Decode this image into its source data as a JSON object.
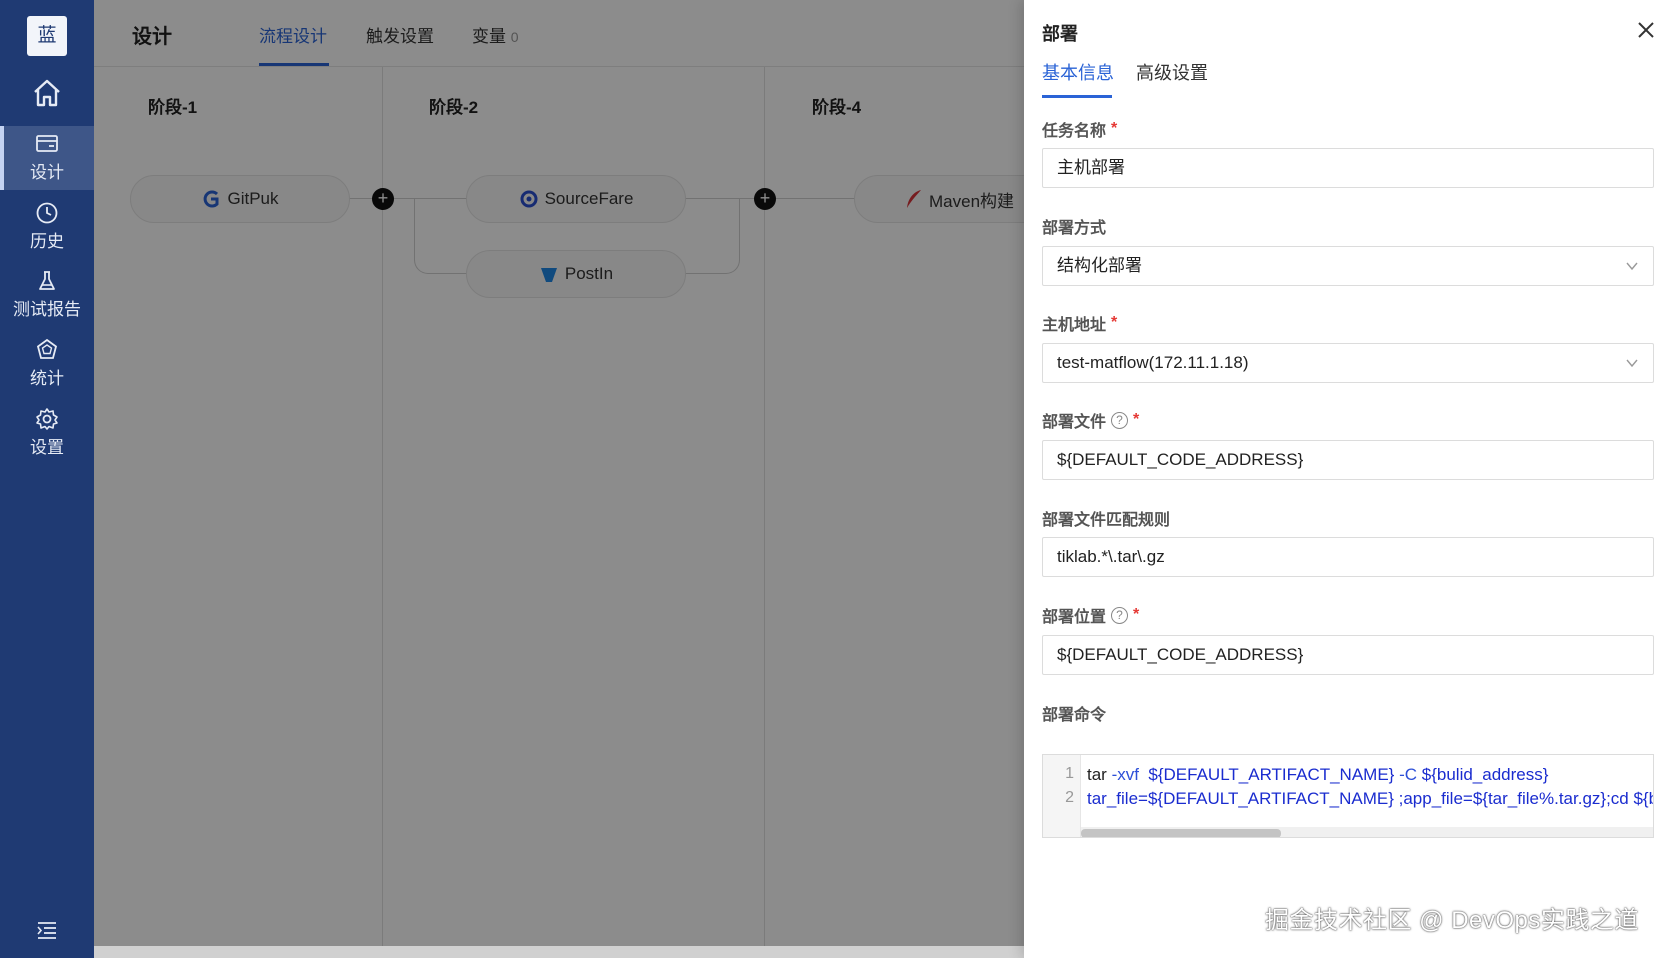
{
  "sidebar": {
    "logo": "蓝",
    "items": [
      {
        "label": "设计",
        "icon": "design-icon",
        "active": true
      },
      {
        "label": "历史",
        "icon": "clock-icon",
        "active": false
      },
      {
        "label": "测试报告",
        "icon": "flask-icon",
        "active": false
      },
      {
        "label": "统计",
        "icon": "chart-icon",
        "active": false
      },
      {
        "label": "设置",
        "icon": "gear-icon",
        "active": false
      }
    ]
  },
  "header": {
    "title": "设计",
    "tabs": [
      {
        "label": "流程设计",
        "active": true
      },
      {
        "label": "触发设置",
        "active": false
      },
      {
        "label": "变量",
        "count": "0",
        "active": false
      }
    ]
  },
  "stages": [
    {
      "title": "阶段-1",
      "tasks": [
        "GitPuk"
      ]
    },
    {
      "title": "阶段-2",
      "tasks": [
        "SourceFare",
        "PostIn"
      ]
    },
    {
      "title": "阶段-4",
      "tasks": [
        "Maven构建"
      ]
    }
  ],
  "drawer": {
    "title": "部署",
    "tabs": [
      {
        "label": "基本信息",
        "active": true
      },
      {
        "label": "高级设置",
        "active": false
      }
    ],
    "fields": {
      "task_name": {
        "label": "任务名称",
        "value": "主机部署"
      },
      "deploy_method": {
        "label": "部署方式",
        "value": "结构化部署"
      },
      "host_address": {
        "label": "主机地址",
        "value": "test-matflow(172.11.1.18)"
      },
      "deploy_file": {
        "label": "部署文件",
        "value": "${DEFAULT_CODE_ADDRESS}"
      },
      "match_rule": {
        "label": "部署文件匹配规则",
        "value": "tiklab.*\\.tar\\.gz"
      },
      "deploy_location": {
        "label": "部署位置",
        "value": "${DEFAULT_CODE_ADDRESS}"
      },
      "deploy_command": {
        "label": "部署命令",
        "lines": [
          {
            "no": "1",
            "a": "tar ",
            "b": "-xvf",
            "c": "  ${DEFAULT_ARTIFACT_NAME} ",
            "d": "-C",
            "e": " ${bulid_address}"
          },
          {
            "no": "2",
            "a": "",
            "b": "",
            "c": "tar_file=${DEFAULT_ARTIFACT_NAME} ;app_file=${tar_file%.tar.gz};cd ${bul",
            "d": "",
            "e": ""
          }
        ]
      }
    }
  },
  "watermark": "掘金技术社区 @ DevOps实践之道",
  "colors": {
    "sidebar": "#1f3a73",
    "accent": "#2a63d6",
    "required": "#e53935"
  }
}
